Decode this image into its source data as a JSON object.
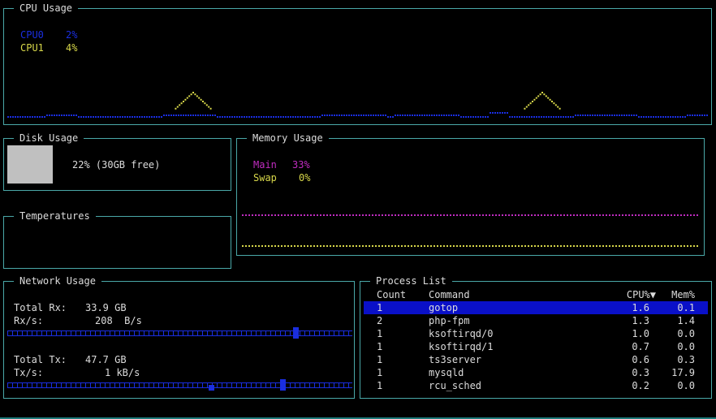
{
  "cpu": {
    "title": "CPU Usage",
    "legend": [
      {
        "label": "CPU0",
        "value": "2%",
        "color": "#1a2ee0"
      },
      {
        "label": "CPU1",
        "value": "4%",
        "color": "#d8d84a"
      }
    ]
  },
  "disk": {
    "title": "Disk Usage",
    "text": "22% (30GB free)"
  },
  "memory": {
    "title": "Memory Usage",
    "legend": [
      {
        "label": "Main",
        "value": "33%",
        "color": "#c02cc0"
      },
      {
        "label": "Swap",
        "value": "0%",
        "color": "#d8d84a"
      }
    ]
  },
  "temperatures": {
    "title": "Temperatures"
  },
  "network": {
    "title": "Network Usage",
    "total_rx_label": "Total Rx:",
    "total_rx_value": "33.9 GB",
    "rx_rate_label": "Rx/s:",
    "rx_rate_value": "208  B/s",
    "total_tx_label": "Total Tx:",
    "total_tx_value": "47.7 GB",
    "tx_rate_label": "Tx/s:",
    "tx_rate_value": "1 kB/s"
  },
  "processes": {
    "title": "Process List",
    "headers": {
      "count": "Count",
      "command": "Command",
      "cpu": "CPU%▼",
      "mem": "Mem%"
    },
    "rows": [
      {
        "count": "1",
        "command": "gotop",
        "cpu": "1.6",
        "mem": "0.1"
      },
      {
        "count": "2",
        "command": "php-fpm",
        "cpu": "1.3",
        "mem": "1.4"
      },
      {
        "count": "1",
        "command": "ksoftirqd/0",
        "cpu": "1.0",
        "mem": "0.0"
      },
      {
        "count": "1",
        "command": "ksoftirqd/1",
        "cpu": "0.7",
        "mem": "0.0"
      },
      {
        "count": "1",
        "command": "ts3server",
        "cpu": "0.6",
        "mem": "0.3"
      },
      {
        "count": "1",
        "command": "mysqld",
        "cpu": "0.3",
        "mem": "17.9"
      },
      {
        "count": "1",
        "command": "rcu_sched",
        "cpu": "0.2",
        "mem": "0.0"
      }
    ],
    "selected_index": 0
  },
  "colors": {
    "border": "#4aa8a8",
    "cpu0": "#1a2ee0",
    "cpu1": "#d8d84a",
    "main": "#c02cc0",
    "swap": "#d8d84a",
    "selection": "#0a10c8"
  }
}
